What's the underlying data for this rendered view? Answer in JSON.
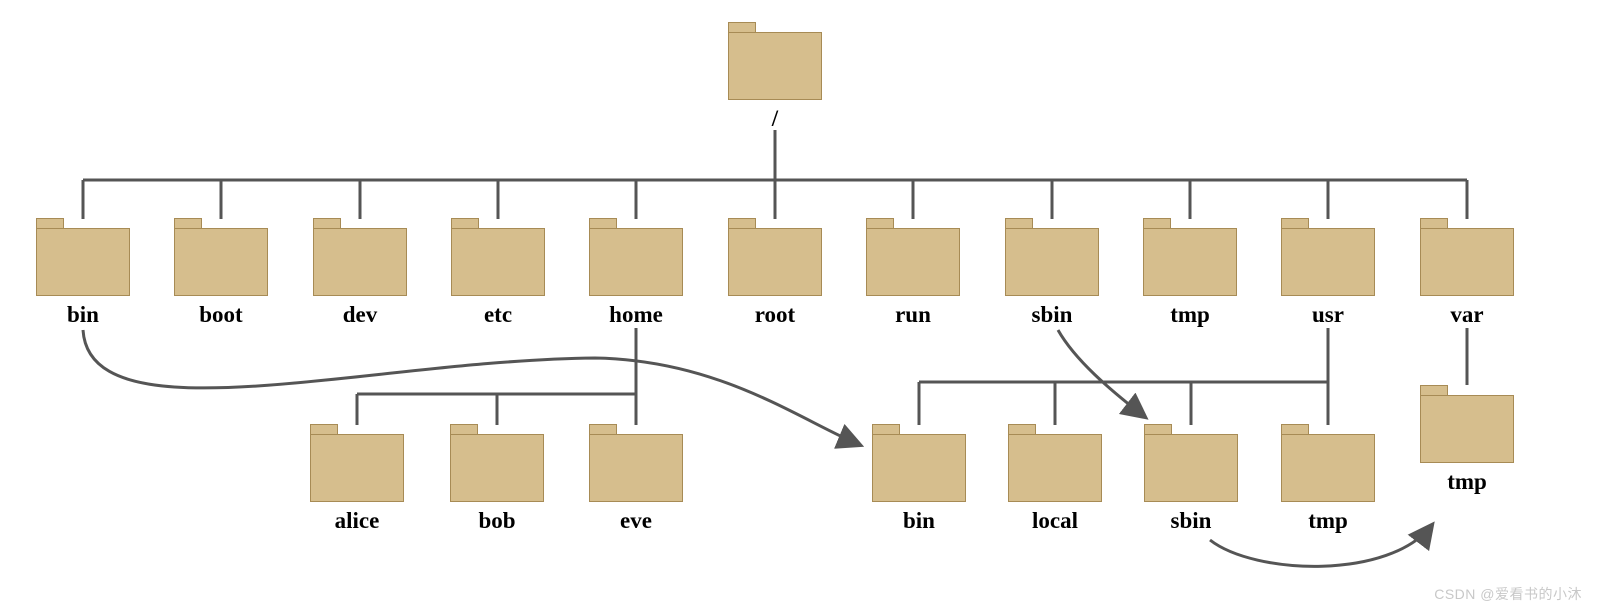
{
  "root": {
    "label": "/"
  },
  "level1": [
    {
      "id": "bin",
      "label": "bin"
    },
    {
      "id": "boot",
      "label": "boot"
    },
    {
      "id": "dev",
      "label": "dev"
    },
    {
      "id": "etc",
      "label": "etc"
    },
    {
      "id": "home",
      "label": "home"
    },
    {
      "id": "root",
      "label": "root"
    },
    {
      "id": "run",
      "label": "run"
    },
    {
      "id": "sbin",
      "label": "sbin"
    },
    {
      "id": "tmp",
      "label": "tmp"
    },
    {
      "id": "usr",
      "label": "usr"
    },
    {
      "id": "var",
      "label": "var"
    }
  ],
  "home_children": [
    {
      "id": "alice",
      "label": "alice"
    },
    {
      "id": "bob",
      "label": "bob"
    },
    {
      "id": "eve",
      "label": "eve"
    }
  ],
  "usr_children": [
    {
      "id": "ubin",
      "label": "bin"
    },
    {
      "id": "ulocal",
      "label": "local"
    },
    {
      "id": "usbin",
      "label": "sbin"
    },
    {
      "id": "utmp",
      "label": "tmp"
    }
  ],
  "var_children": [
    {
      "id": "vtmp",
      "label": "tmp"
    }
  ],
  "symlinks": [
    {
      "from": "bin",
      "to": "usr/bin"
    },
    {
      "from": "sbin",
      "to": "usr/sbin"
    },
    {
      "from": "tmp",
      "to": "var/tmp"
    }
  ],
  "watermark": "CSDN @爱看书的小沐",
  "colors": {
    "folder_fill": "#d6be8d",
    "folder_border": "#a78b55",
    "line": "#555555"
  }
}
